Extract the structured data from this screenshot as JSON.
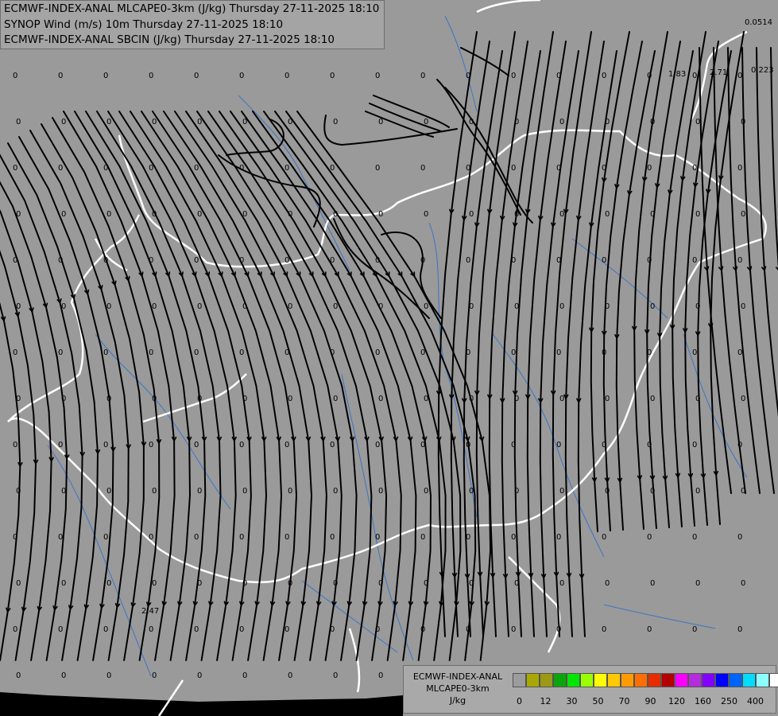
{
  "titles": [
    "ECMWF-INDEX-ANAL MLCAPE0-3km (J/kg) Thursday 27-11-2025 18:10",
    "SYNOP Wind (m/s) 10m Thursday 27-11-2025 18:10",
    "ECMWF-INDEX-ANAL SBCIN (J/kg) Thursday 27-11-2025 18:10"
  ],
  "legend": {
    "line1": "ECMWF-INDEX-ANAL",
    "line2": "MLCAPE0-3km",
    "unit": "J/kg",
    "colors": [
      "#9c9c9c",
      "#a8a800",
      "#9a9a16",
      "#0da50d",
      "#00e600",
      "#9aff00",
      "#ffff00",
      "#ffc800",
      "#ff9b00",
      "#ff6e00",
      "#e62d00",
      "#b40000",
      "#ff00ff",
      "#b42ddc",
      "#8200ff",
      "#0000ff",
      "#0064ff",
      "#00dcff",
      "#8cffff",
      "#ffffff"
    ],
    "ticks": [
      {
        "label": "0",
        "pos": 1
      },
      {
        "label": "12",
        "pos": 3
      },
      {
        "label": "30",
        "pos": 5
      },
      {
        "label": "50",
        "pos": 7
      },
      {
        "label": "70",
        "pos": 9
      },
      {
        "label": "90",
        "pos": 11
      },
      {
        "label": "120",
        "pos": 13
      },
      {
        "label": "160",
        "pos": 15
      },
      {
        "label": "250",
        "pos": 17
      },
      {
        "label": "400",
        "pos": 19
      }
    ]
  },
  "map": {
    "background_color": "#9a9a9a",
    "sea_color": "#000000",
    "streamline_color": "#000000",
    "border_color": "#ffffff",
    "river_color": "#3b74c6",
    "station_labels": [
      "0.0514",
      "1.83",
      "2.71",
      "0.223",
      "2.47"
    ],
    "default_value_label": "0"
  }
}
